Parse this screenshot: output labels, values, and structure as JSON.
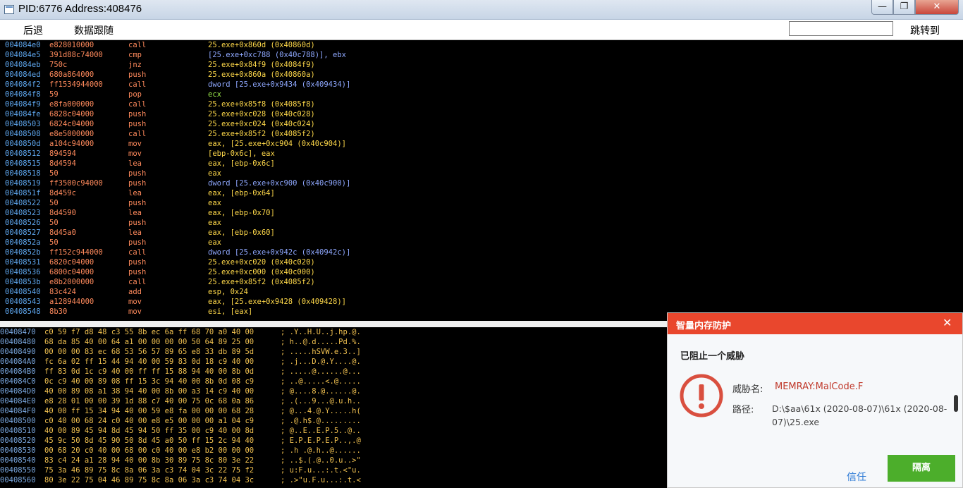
{
  "window": {
    "title": "PID:6776  Address:408476",
    "min": "—",
    "max": "❐",
    "close": "✕"
  },
  "toolbar": {
    "back": "后退",
    "follow": "数据跟随",
    "address_value": "",
    "goto": "跳转到"
  },
  "disasm": [
    {
      "addr": "004084e0",
      "bytes": "e828010000",
      "mn": "call",
      "op": "25.exe+0x860d (0x40860d)",
      "t": ""
    },
    {
      "addr": "004084e5",
      "bytes": "391d88c74000",
      "mn": "cmp",
      "op": "[25.exe+0xc788 (0x40c788)], ebx",
      "t": "dw"
    },
    {
      "addr": "004084eb",
      "bytes": "750c",
      "mn": "jnz",
      "op": "25.exe+0x84f9 (0x4084f9)",
      "t": ""
    },
    {
      "addr": "004084ed",
      "bytes": "680a864000",
      "mn": "push",
      "op": "25.exe+0x860a (0x40860a)",
      "t": ""
    },
    {
      "addr": "004084f2",
      "bytes": "ff1534944000",
      "mn": "call",
      "op": "dword [25.exe+0x9434 (0x409434)]",
      "t": "dw"
    },
    {
      "addr": "004084f8",
      "bytes": "59",
      "mn": "pop",
      "op": "ecx",
      "t": "reg"
    },
    {
      "addr": "004084f9",
      "bytes": "e8fa000000",
      "mn": "call",
      "op": "25.exe+0x85f8 (0x4085f8)",
      "t": ""
    },
    {
      "addr": "004084fe",
      "bytes": "6828c04000",
      "mn": "push",
      "op": "25.exe+0xc028 (0x40c028)",
      "t": ""
    },
    {
      "addr": "00408503",
      "bytes": "6824c04000",
      "mn": "push",
      "op": "25.exe+0xc024 (0x40c024)",
      "t": ""
    },
    {
      "addr": "00408508",
      "bytes": "e8e5000000",
      "mn": "call",
      "op": "25.exe+0x85f2 (0x4085f2)",
      "t": ""
    },
    {
      "addr": "0040850d",
      "bytes": "a104c94000",
      "mn": "mov",
      "op": "eax, [25.exe+0xc904 (0x40c904)]",
      "t": ""
    },
    {
      "addr": "00408512",
      "bytes": "894594",
      "mn": "mov",
      "op": "[ebp-0x6c], eax",
      "t": ""
    },
    {
      "addr": "00408515",
      "bytes": "8d4594",
      "mn": "lea",
      "op": "eax, [ebp-0x6c]",
      "t": ""
    },
    {
      "addr": "00408518",
      "bytes": "50",
      "mn": "push",
      "op": "eax",
      "t": ""
    },
    {
      "addr": "00408519",
      "bytes": "ff3500c94000",
      "mn": "push",
      "op": "dword [25.exe+0xc900 (0x40c900)]",
      "t": "dw"
    },
    {
      "addr": "0040851f",
      "bytes": "8d459c",
      "mn": "lea",
      "op": "eax, [ebp-0x64]",
      "t": ""
    },
    {
      "addr": "00408522",
      "bytes": "50",
      "mn": "push",
      "op": "eax",
      "t": ""
    },
    {
      "addr": "00408523",
      "bytes": "8d4590",
      "mn": "lea",
      "op": "eax, [ebp-0x70]",
      "t": ""
    },
    {
      "addr": "00408526",
      "bytes": "50",
      "mn": "push",
      "op": "eax",
      "t": ""
    },
    {
      "addr": "00408527",
      "bytes": "8d45a0",
      "mn": "lea",
      "op": "eax, [ebp-0x60]",
      "t": ""
    },
    {
      "addr": "0040852a",
      "bytes": "50",
      "mn": "push",
      "op": "eax",
      "t": ""
    },
    {
      "addr": "0040852b",
      "bytes": "ff152c944000",
      "mn": "call",
      "op": "dword [25.exe+0x942c (0x40942c)]",
      "t": "dw"
    },
    {
      "addr": "00408531",
      "bytes": "6820c04000",
      "mn": "push",
      "op": "25.exe+0xc020 (0x40c020)",
      "t": ""
    },
    {
      "addr": "00408536",
      "bytes": "6800c04000",
      "mn": "push",
      "op": "25.exe+0xc000 (0x40c000)",
      "t": ""
    },
    {
      "addr": "0040853b",
      "bytes": "e8b2000000",
      "mn": "call",
      "op": "25.exe+0x85f2 (0x4085f2)",
      "t": ""
    },
    {
      "addr": "00408540",
      "bytes": "83c424",
      "mn": "add",
      "op": "esp, 0x24",
      "t": ""
    },
    {
      "addr": "00408543",
      "bytes": "a128944000",
      "mn": "mov",
      "op": "eax, [25.exe+0x9428 (0x409428)]",
      "t": ""
    },
    {
      "addr": "00408548",
      "bytes": "8b30",
      "mn": "mov",
      "op": "esi, [eax]",
      "t": ""
    }
  ],
  "hexdump": [
    {
      "addr": "00408470",
      "bytes": "c0 59 f7 d8 48 c3 55 8b ec 6a ff 68 70 a0 40 00",
      "ascii": "; .Y..H.U..j.hp.@."
    },
    {
      "addr": "00408480",
      "bytes": "68 da 85 40 00 64 a1 00 00 00 00 50 64 89 25 00",
      "ascii": "; h..@.d.....Pd.%."
    },
    {
      "addr": "00408490",
      "bytes": "00 00 00 83 ec 68 53 56 57 89 65 e8 33 db 89 5d",
      "ascii": "; .....hSVW.e.3..]"
    },
    {
      "addr": "004084A0",
      "bytes": "fc 6a 02 ff 15 44 94 40 00 59 83 0d 18 c9 40 00",
      "ascii": "; .j...D.@.Y....@."
    },
    {
      "addr": "004084B0",
      "bytes": "ff 83 0d 1c c9 40 00 ff ff 15 88 94 40 00 8b 0d",
      "ascii": "; .....@......@..."
    },
    {
      "addr": "004084C0",
      "bytes": "0c c9 40 00 89 08 ff 15 3c 94 40 00 8b 0d 08 c9",
      "ascii": "; ..@.....<.@....."
    },
    {
      "addr": "004084D0",
      "bytes": "40 00 89 08 a1 38 94 40 00 8b 00 a3 14 c9 40 00",
      "ascii": "; @....8.@......@."
    },
    {
      "addr": "004084E0",
      "bytes": "e8 28 01 00 00 39 1d 88 c7 40 00 75 0c 68 0a 86",
      "ascii": "; .(...9...@.u.h.."
    },
    {
      "addr": "004084F0",
      "bytes": "40 00 ff 15 34 94 40 00 59 e8 fa 00 00 00 68 28",
      "ascii": "; @...4.@.Y.....h("
    },
    {
      "addr": "00408500",
      "bytes": "c0 40 00 68 24 c0 40 00 e8 e5 00 00 00 a1 04 c9",
      "ascii": "; .@.h$.@........."
    },
    {
      "addr": "00408510",
      "bytes": "40 00 89 45 94 8d 45 94 50 ff 35 00 c9 40 00 8d",
      "ascii": "; @..E..E.P.5..@.."
    },
    {
      "addr": "00408520",
      "bytes": "45 9c 50 8d 45 90 50 8d 45 a0 50 ff 15 2c 94 40",
      "ascii": "; E.P.E.P.E.P..,.@"
    },
    {
      "addr": "00408530",
      "bytes": "00 68 20 c0 40 00 68 00 c0 40 00 e8 b2 00 00 00",
      "ascii": "; .h .@.h..@......"
    },
    {
      "addr": "00408540",
      "bytes": "83 c4 24 a1 28 94 40 00 8b 30 89 75 8c 80 3e 22",
      "ascii": "; ..$.(.@..0.u..>\""
    },
    {
      "addr": "00408550",
      "bytes": "75 3a 46 89 75 8c 8a 06 3a c3 74 04 3c 22 75 f2",
      "ascii": "; u:F.u...:.t.<\"u."
    },
    {
      "addr": "00408560",
      "bytes": "80 3e 22 75 04 46 89 75 8c 8a 06 3a c3 74 04 3c",
      "ascii": "; .>\"u.F.u...:.t.<"
    }
  ],
  "popup": {
    "title": "智量内存防护",
    "close": "✕",
    "subtitle": "已阻止一个威胁",
    "threat_label": "威胁名:",
    "threat_value": "MEMRAY:MalCode.F",
    "path_label": "路径:",
    "path_value": "D:\\$aa\\61x (2020-08-07)\\61x (2020-08-07)\\25.exe",
    "trust": "信任",
    "quarantine": "隔离"
  },
  "colors": {
    "accent_red": "#e9472d",
    "quarantine_green": "#4cae2b",
    "link_blue": "#2e7bd6"
  }
}
